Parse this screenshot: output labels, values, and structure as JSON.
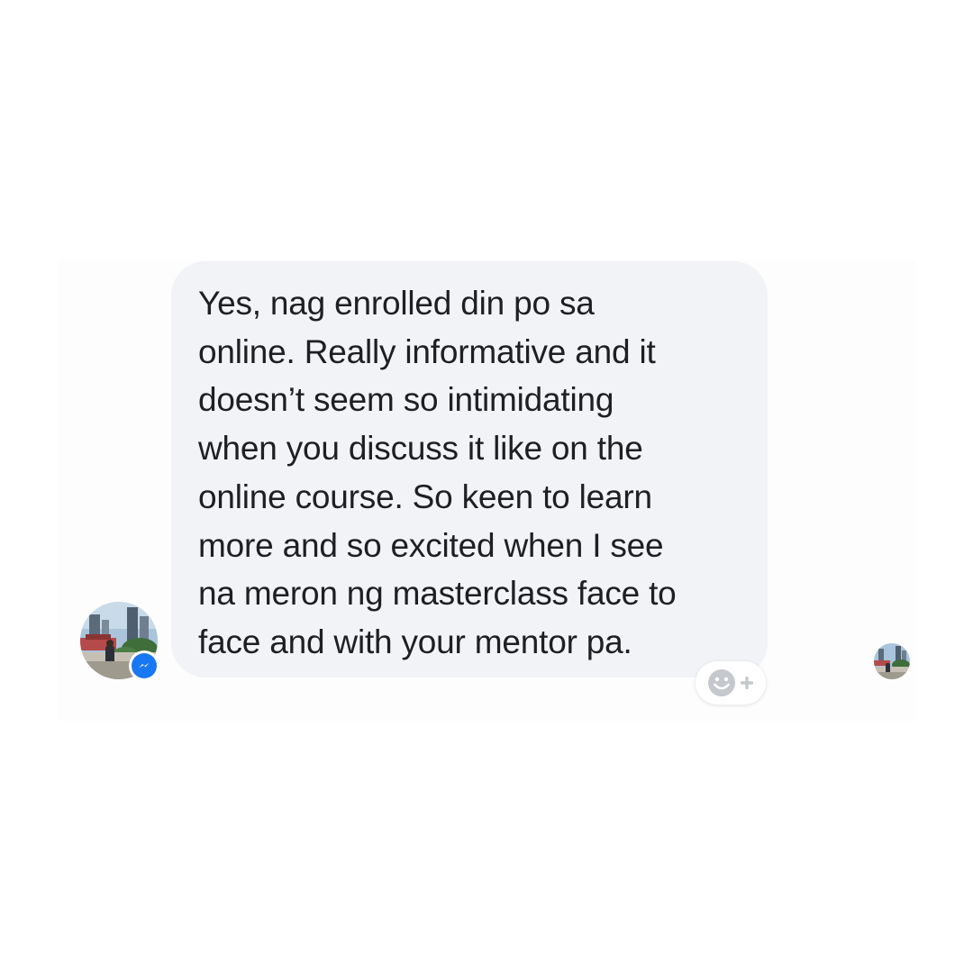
{
  "conversation": {
    "message": {
      "text": "Yes, nag enrolled din po sa\nonline. Really informative and it\ndoesn’t seem so intimidating\nwhen you discuss it like on the\nonline course. So keen to learn\nmore and so excited when I see\nna meron ng masterclass face to\nface and with your mentor pa."
    },
    "sender": {
      "avatar_icon": "profile-photo-city",
      "badge_icon": "messenger-icon"
    },
    "reaction": {
      "icon": "smiley-plus-icon"
    },
    "seen_indicator": {
      "icon": "profile-photo-city"
    }
  },
  "colors": {
    "bubble": "#f1f3f6",
    "text": "#1d1f23",
    "messenger_blue": "#1877f2",
    "reaction_icon": "#c5c8cd"
  }
}
